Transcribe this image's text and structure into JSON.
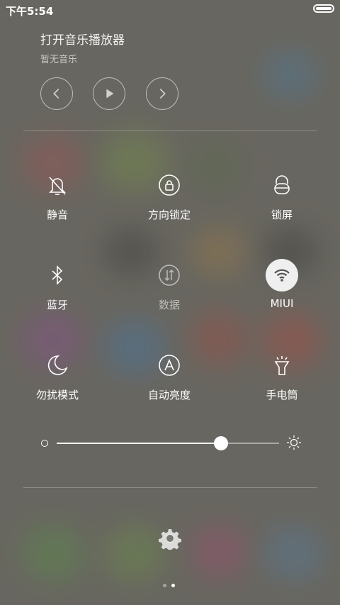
{
  "status_bar": {
    "time": "下午5:54"
  },
  "music": {
    "title": "打开音乐播放器",
    "subtitle": "暂无音乐"
  },
  "controls": [
    "previous-icon",
    "play-icon",
    "next-icon"
  ],
  "toggles": [
    {
      "label": "静音",
      "icon": "mute-bell-icon",
      "state": "off"
    },
    {
      "label": "方向锁定",
      "icon": "rotation-lock-icon",
      "state": "off"
    },
    {
      "label": "锁屏",
      "icon": "lock-icon",
      "state": "off"
    },
    {
      "label": "蓝牙",
      "icon": "bluetooth-icon",
      "state": "off"
    },
    {
      "label": "数据",
      "icon": "mobile-data-icon",
      "state": "disabled"
    },
    {
      "label": "MIUI",
      "icon": "wifi-icon",
      "state": "on"
    },
    {
      "label": "勿扰模式",
      "icon": "moon-icon",
      "state": "off"
    },
    {
      "label": "自动亮度",
      "icon": "auto-brightness-icon",
      "state": "off"
    },
    {
      "label": "手电筒",
      "icon": "flashlight-icon",
      "state": "off"
    }
  ],
  "brightness": {
    "level": 0.74
  },
  "pager": {
    "pages": 2,
    "current": 2
  },
  "colors": {
    "accent": "#ffffff",
    "panel_overlay": "#67655f",
    "active_toggle_bg": "#efefef"
  }
}
